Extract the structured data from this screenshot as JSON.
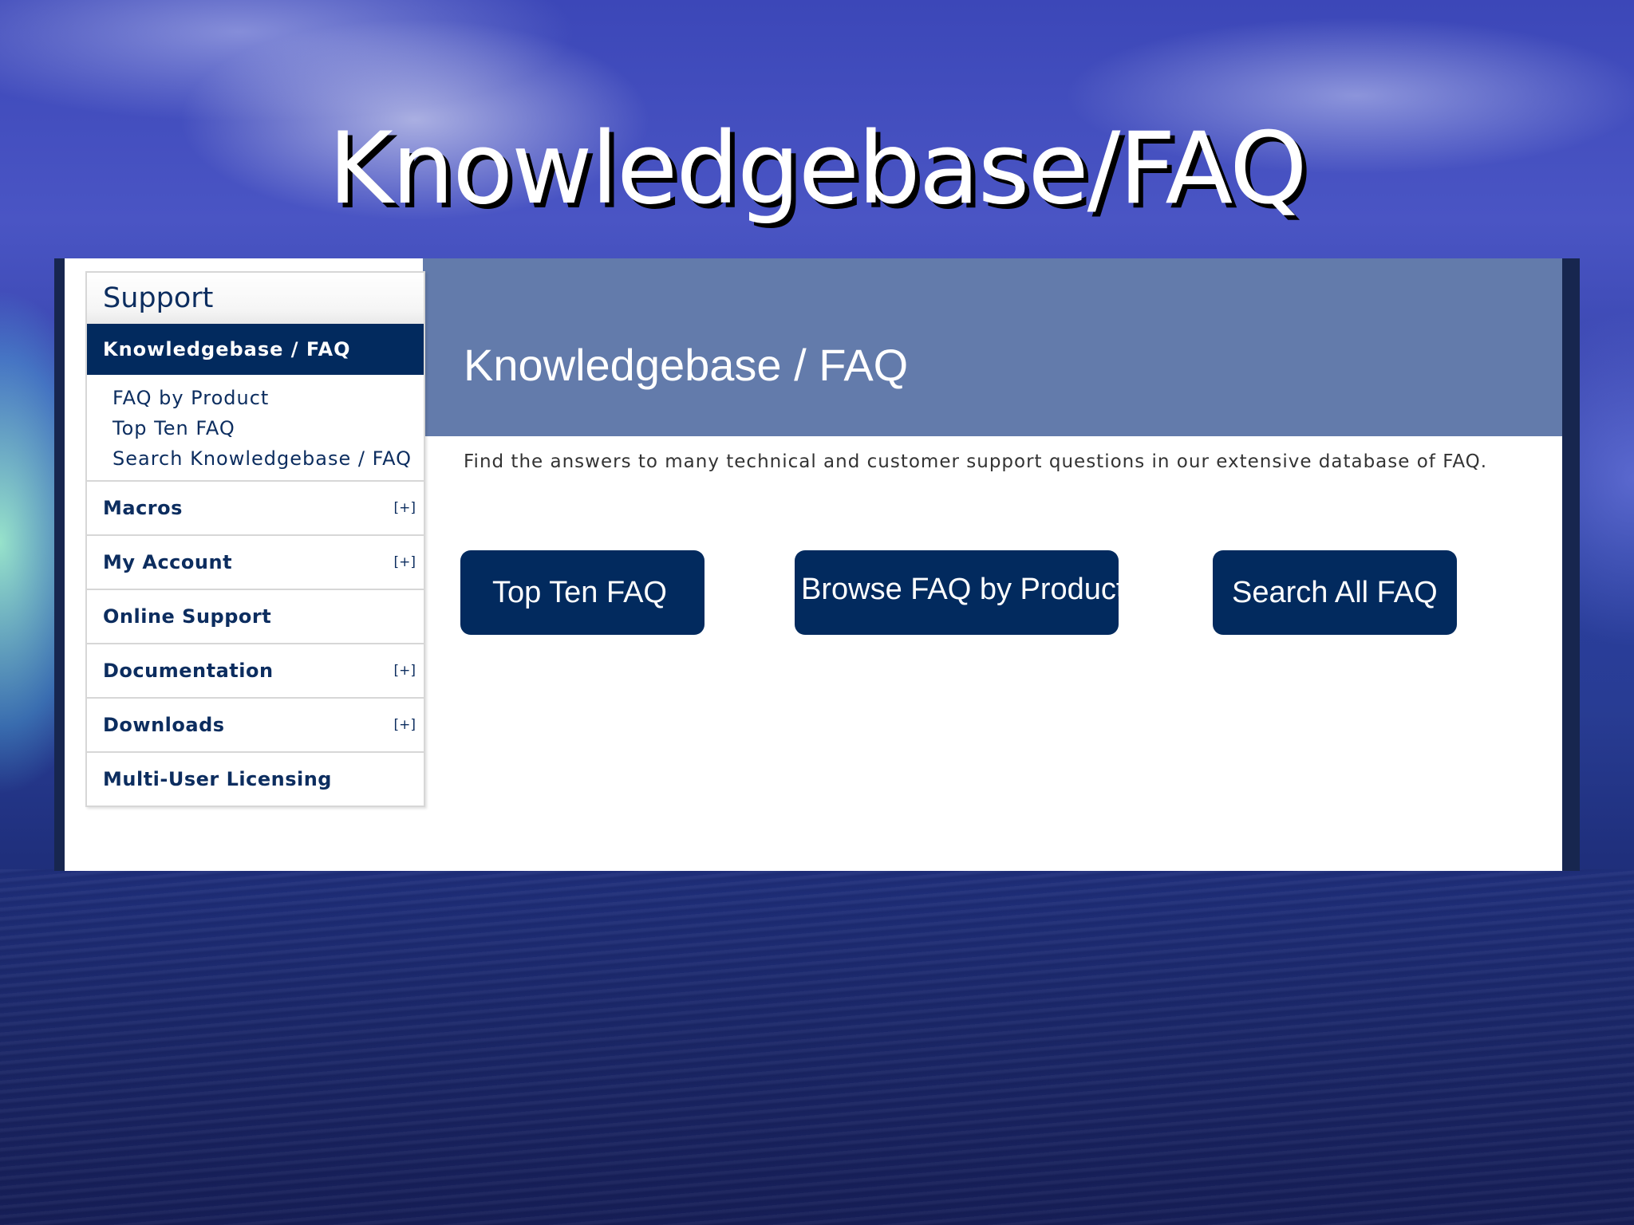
{
  "slide": {
    "title": "Knowledgebase/FAQ"
  },
  "sidebar": {
    "heading": "Support",
    "active_item": "Knowledgebase / FAQ",
    "sub_items": [
      {
        "label": "FAQ by Product"
      },
      {
        "label": "Top Ten FAQ"
      },
      {
        "label": "Search Knowledgebase / FAQ"
      }
    ],
    "items": [
      {
        "label": "Macros",
        "expand": "[+]"
      },
      {
        "label": "My Account",
        "expand": "[+]"
      },
      {
        "label": "Online Support",
        "expand": ""
      },
      {
        "label": "Documentation",
        "expand": "[+]"
      },
      {
        "label": "Downloads",
        "expand": "[+]"
      },
      {
        "label": "Multi-User Licensing",
        "expand": ""
      }
    ]
  },
  "main": {
    "title": "Knowledgebase / FAQ",
    "intro": "Find the answers to many technical and customer support questions in our extensive database of FAQ.",
    "buttons": {
      "top_ten": "Top Ten FAQ",
      "browse": "Browse FAQ by Product",
      "search": "Search All FAQ"
    }
  },
  "colors": {
    "navy": "#022a5e",
    "header_band": "#637bab",
    "link_text": "#0c2d5f"
  }
}
